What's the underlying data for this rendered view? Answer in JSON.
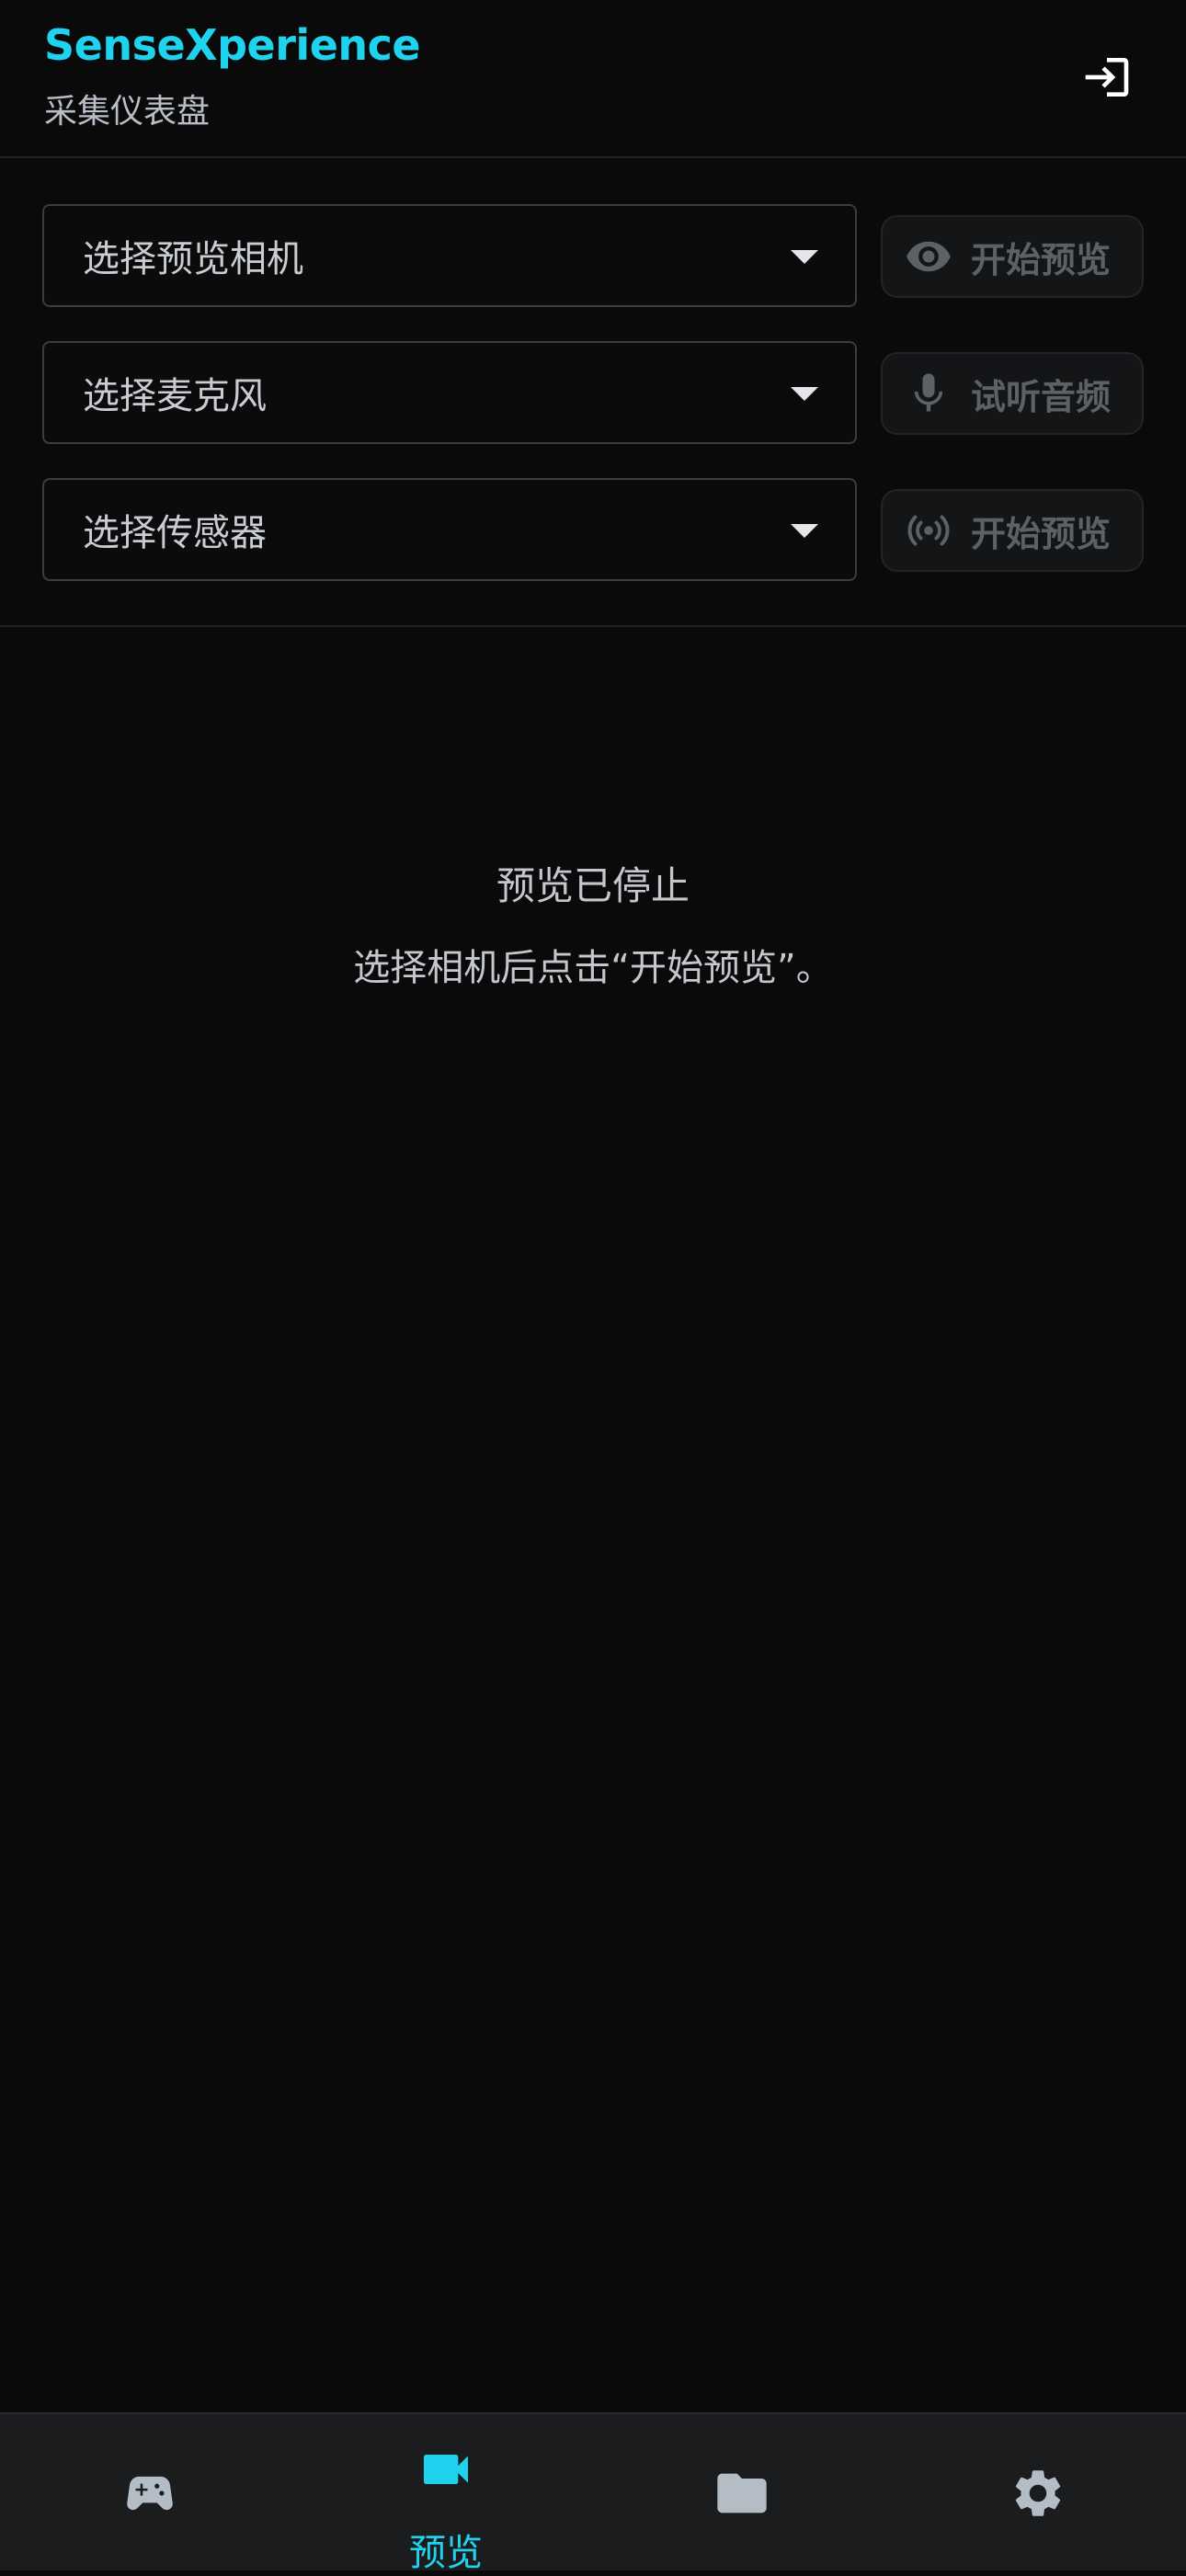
{
  "header": {
    "title": "SenseXperience",
    "subtitle": "采集仪表盘",
    "login_icon": "login-icon"
  },
  "colors": {
    "accent": "#1fd3ee",
    "background": "#0a0a0b",
    "nav_background": "#1b1c1e",
    "disabled_text": "#5d6166"
  },
  "controls": {
    "camera": {
      "select_label": "选择预览相机",
      "button_label": "开始预览",
      "button_icon": "eye-icon"
    },
    "microphone": {
      "select_label": "选择麦克风",
      "button_label": "试听音频",
      "button_icon": "microphone-icon"
    },
    "sensor": {
      "select_label": "选择传感器",
      "button_label": "开始预览",
      "button_icon": "broadcast-icon"
    }
  },
  "main": {
    "status_title": "预览已停止",
    "status_desc": "选择相机后点击“开始预览”。"
  },
  "bottom_nav": {
    "items": [
      {
        "icon": "gamepad-icon",
        "label": "",
        "active": false
      },
      {
        "icon": "video-camera-icon",
        "label": "预览",
        "active": true
      },
      {
        "icon": "folder-icon",
        "label": "",
        "active": false
      },
      {
        "icon": "gear-icon",
        "label": "",
        "active": false
      }
    ]
  }
}
